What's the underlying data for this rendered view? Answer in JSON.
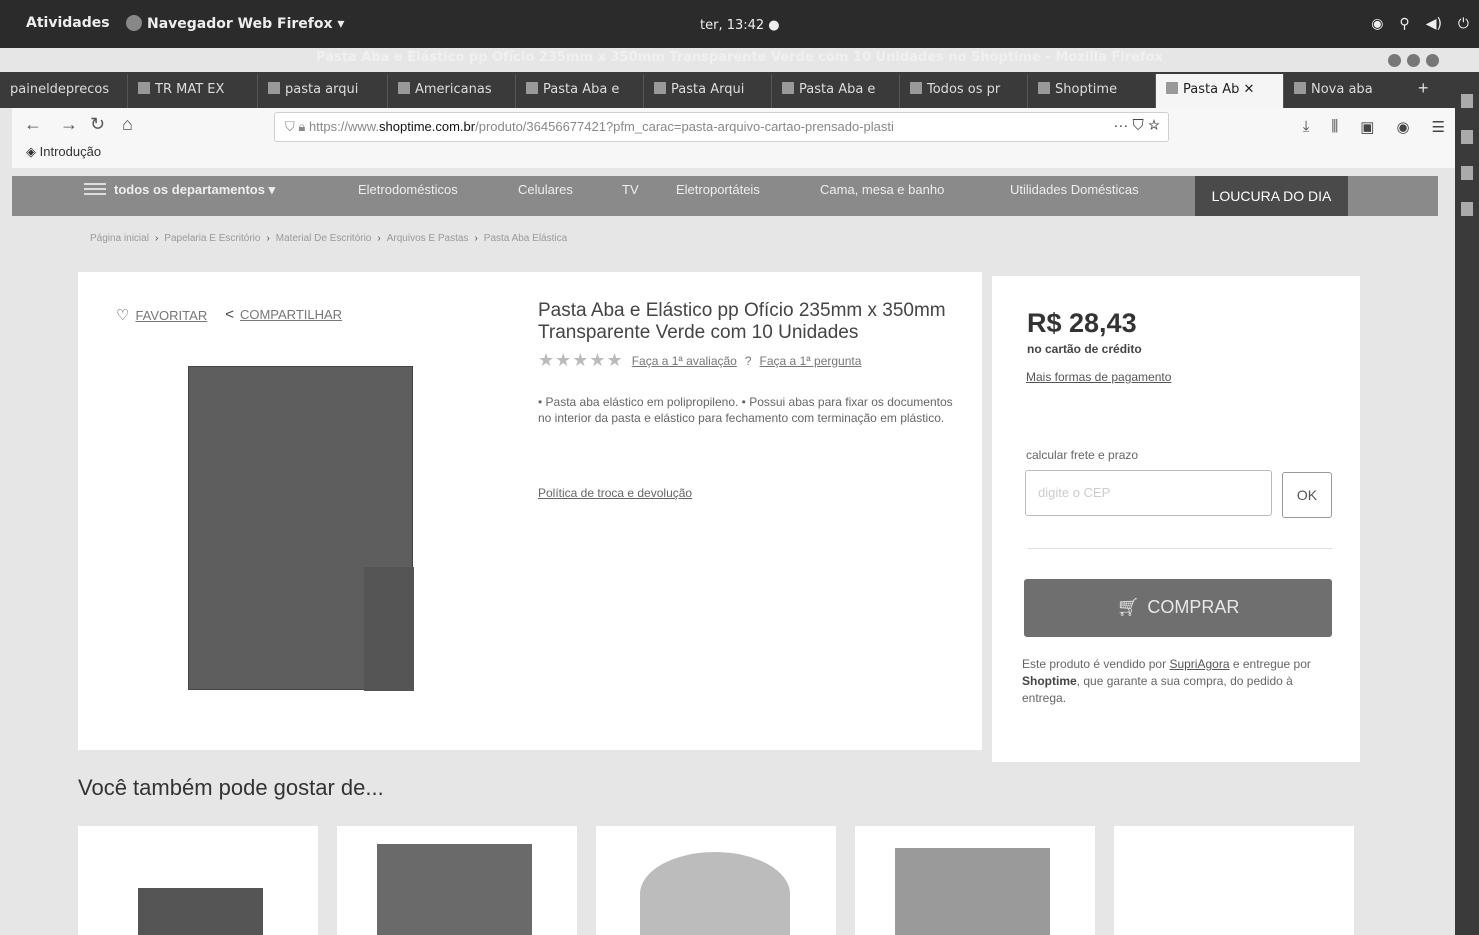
{
  "system": {
    "activities": "Atividades",
    "app_menu": "Navegador Web Firefox ▾",
    "clock": "ter, 13:42 ●"
  },
  "window": {
    "title": "Pasta Aba e Elástico pp Ofício 235mm x 350mm Transparente Verde com 10 Unidades no Shoptime - Mozilla Firefox"
  },
  "tabs": [
    {
      "label": "paineldeprecos"
    },
    {
      "label": "TR MAT EX"
    },
    {
      "label": "pasta arqui"
    },
    {
      "label": "Americanas"
    },
    {
      "label": "Pasta Aba e"
    },
    {
      "label": "Pasta Arqui"
    },
    {
      "label": "Pasta Aba e"
    },
    {
      "label": "Todos os pr"
    },
    {
      "label": "Shoptime"
    },
    {
      "label": "Pasta Ab",
      "active": true
    },
    {
      "label": "Nova aba"
    }
  ],
  "browser": {
    "url_prefix": "https://www.",
    "url_host": "shoptime.com.br",
    "url_path": "/produto/36456677421?pfm_carac=pasta-arquivo-cartao-prensado-plasti",
    "bookmark": "Introdução"
  },
  "site": {
    "departments": "todos os departamentos ▾",
    "nav": [
      "Eletrodomésticos",
      "Celulares",
      "TV",
      "Eletroportáteis",
      "Cama, mesa e banho",
      "Utilidades Domésticas"
    ],
    "highlight": "LOUCURA DO DIA"
  },
  "breadcrumb": [
    "Página inicial",
    "Papelaria E Escritório",
    "Material De Escritório",
    "Arquivos E Pastas",
    "Pasta Aba Elástica"
  ],
  "product": {
    "favorite": "FAVORITAR",
    "share": "COMPARTILHAR",
    "title": "Pasta Aba e Elástico pp Ofício 235mm x 350mm Transparente Verde com 10 Unidades",
    "stars": "★★★★★",
    "first_review": "Faça a 1ª avaliação",
    "first_question": "Faça a 1ª pergunta",
    "description": "• Pasta aba elástico em polipropileno. • Possui abas para fixar os documentos no interior da pasta e elástico para fechamento com terminação em plástico.",
    "policy": "Política de troca e devolução"
  },
  "buy": {
    "price": "R$ 28,43",
    "price_note": "no cartão de crédito",
    "more_payment": "Mais formas de pagamento",
    "shipping_label": "calcular frete e prazo",
    "cep_placeholder": "digite o CEP",
    "ok": "OK",
    "buy_button": "COMPRAR",
    "seller_prefix": "Este produto é vendido por",
    "seller_name": "SupriAgora",
    "seller_mid": "e entregue por",
    "seller_delivery": "Shoptime",
    "seller_suffix": ", que garante a sua compra, do pedido à entrega."
  },
  "recommend": {
    "title": "Você também pode gostar de..."
  }
}
